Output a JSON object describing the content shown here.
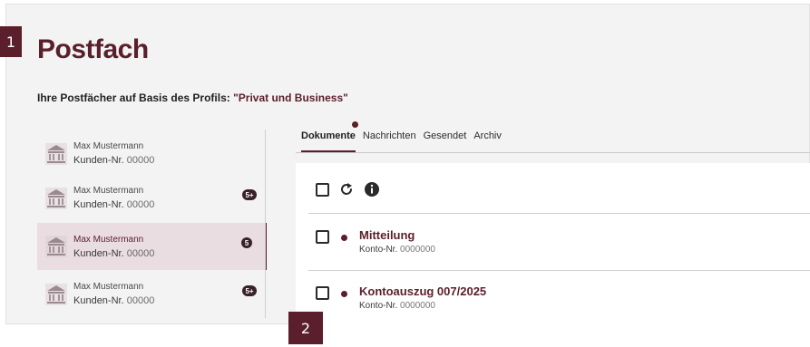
{
  "markers": [
    "1",
    "2"
  ],
  "page": {
    "title": "Postfach",
    "subtitle_prefix": "Ihre Postfächer auf Basis des Profils: ",
    "subtitle_profile": "\"Privat und Business\""
  },
  "accounts": [
    {
      "name": "Max Mustermann",
      "kunde_label": "Kunden-Nr.",
      "kunde_nr": "00000",
      "badge": "",
      "active": false
    },
    {
      "name": "Max Mustermann",
      "kunde_label": "Kunden-Nr.",
      "kunde_nr": "00000",
      "badge": "5+",
      "active": false
    },
    {
      "name": "Max Mustermann",
      "kunde_label": "Kunden-Nr.",
      "kunde_nr": "00000",
      "badge": "5",
      "active": true
    },
    {
      "name": "Max Mustermann",
      "kunde_label": "Kunden-Nr.",
      "kunde_nr": "00000",
      "badge": "5+",
      "active": false
    }
  ],
  "tabs": [
    {
      "label": "Dokumente",
      "active": true
    },
    {
      "label": "Nachrichten",
      "active": false
    },
    {
      "label": "Gesendet",
      "active": false
    },
    {
      "label": "Archiv",
      "active": false
    }
  ],
  "toolbar": {
    "icons": [
      "select-all-checkbox",
      "refresh-icon",
      "info-icon"
    ]
  },
  "messages": [
    {
      "title": "Mitteilung",
      "konto_label": "Konto-Nr.",
      "konto_nr": "0000000",
      "unread": true
    },
    {
      "title": "Kontoauszug 007/2025",
      "konto_label": "Konto-Nr.",
      "konto_nr": "0000000",
      "unread": true
    }
  ],
  "colors": {
    "brand": "#5a1f2b",
    "active_bg": "#eadde1",
    "frame_bg": "#f3f3f3"
  }
}
